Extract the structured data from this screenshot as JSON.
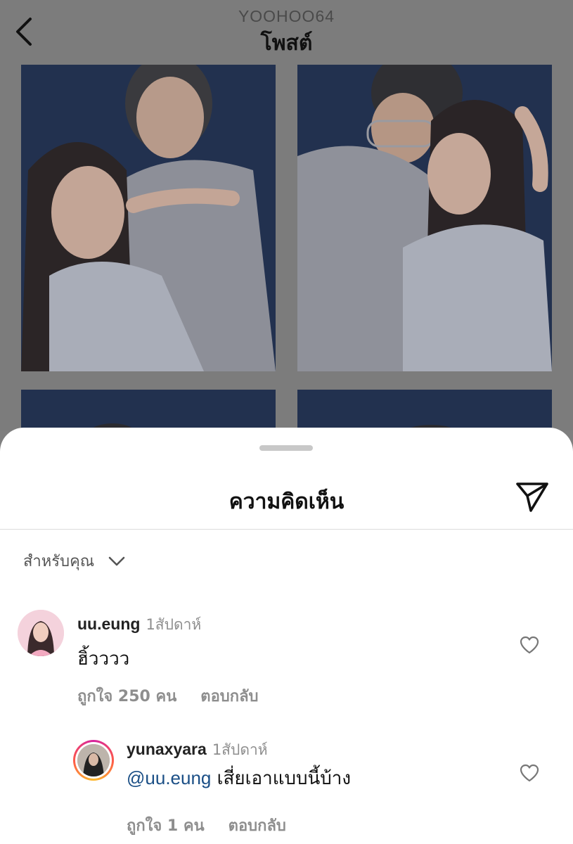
{
  "header": {
    "username": "YOOHOO64",
    "title": "โพสต์",
    "back_icon": "chevron-left-icon"
  },
  "sheet": {
    "title": "ความคิดเห็น",
    "share_icon": "send-icon",
    "filter_label": "สำหรับคุณ",
    "filter_icon": "chevron-down-icon"
  },
  "comments": [
    {
      "username": "uu.eung",
      "time": "1สัปดาห์",
      "text": "ฮิ้วววว",
      "likes": "ถูกใจ 250 คน",
      "reply_label": "ตอบกลับ"
    },
    {
      "username": "yunaxyara",
      "time": "1สัปดาห์",
      "mention": "@uu.eung",
      "text": "เสี่ยเอาแบบนี้บ้าง",
      "likes": "ถูกใจ 1 คน",
      "reply_label": "ตอบกลับ"
    }
  ],
  "colors": {
    "mention": "#1b4f86",
    "secondary_text": "#8e8e8e",
    "photo_backdrop": "#23355a"
  }
}
